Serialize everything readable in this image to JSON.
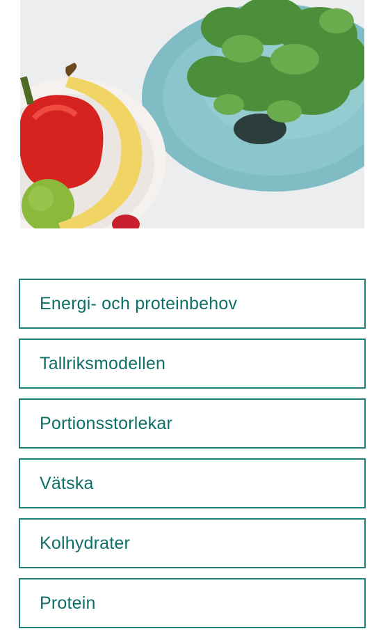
{
  "hero": {
    "image": "food-photo-vegetables-fruit"
  },
  "menu": {
    "items": [
      {
        "label": "Energi- och proteinbehov"
      },
      {
        "label": "Tallriksmodellen"
      },
      {
        "label": "Portionsstorlekar"
      },
      {
        "label": "Vätska"
      },
      {
        "label": "Kolhydrater"
      },
      {
        "label": "Protein"
      }
    ]
  },
  "colors": {
    "accent": "#1f8178",
    "text": "#0e6f68",
    "background": "#ffffff"
  }
}
